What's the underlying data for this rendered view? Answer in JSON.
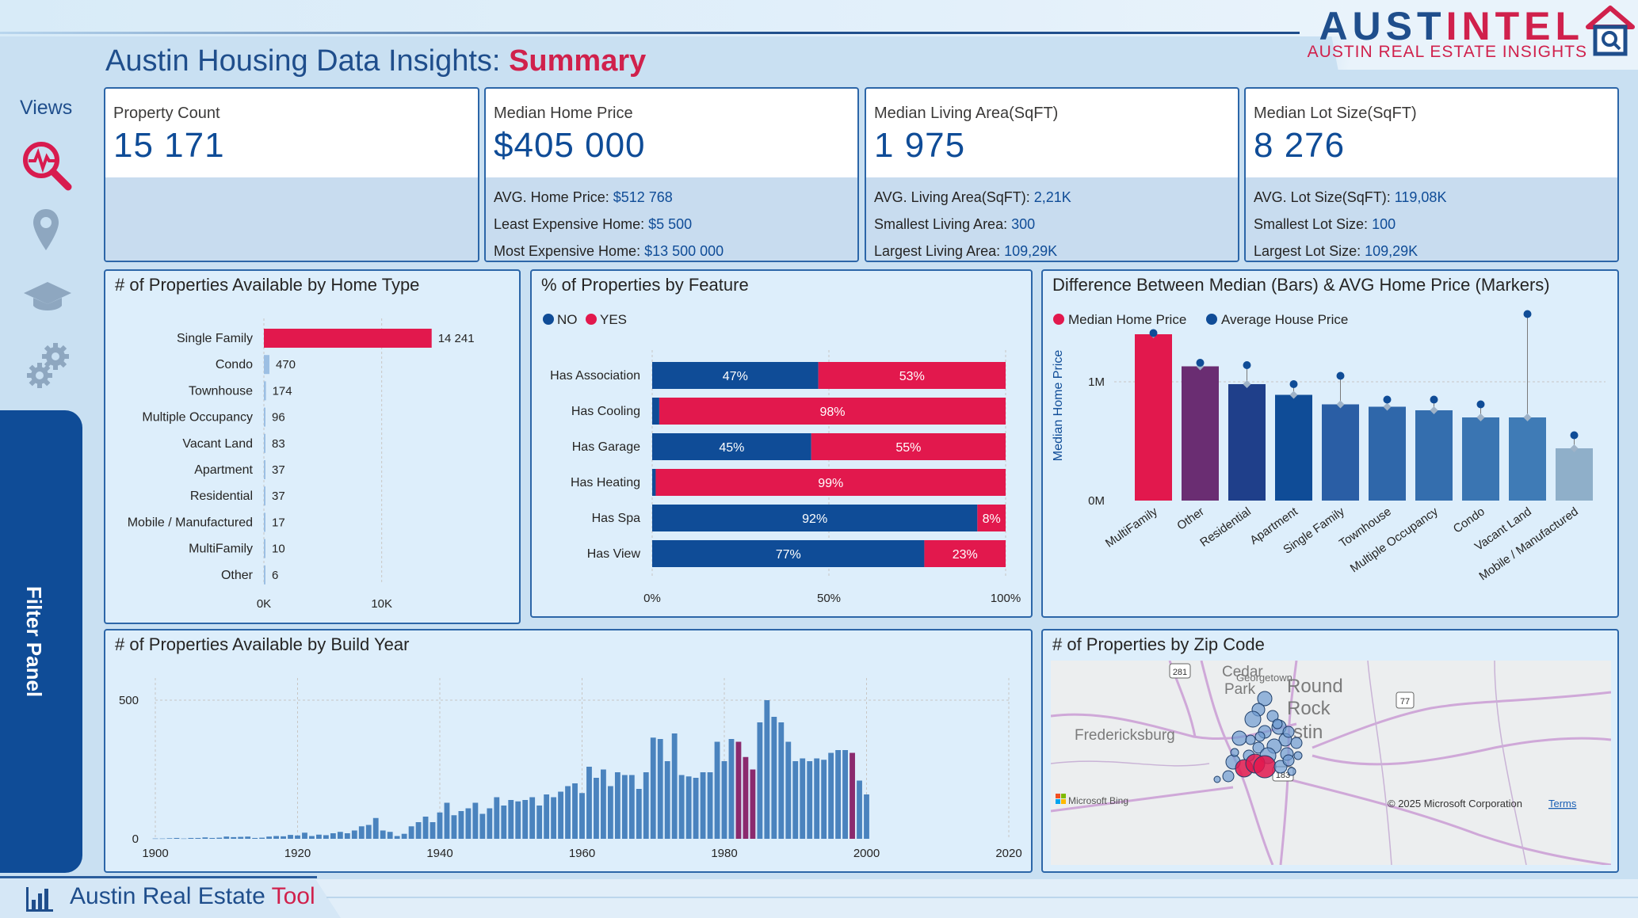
{
  "logo": {
    "word_blue": "AUST",
    "word_red": "INTEL",
    "subtitle": "AUSTIN REAL ESTATE INSIGHTS"
  },
  "title": {
    "main": "Austin Housing Data Insights: ",
    "accent": "Summary"
  },
  "sidebar": {
    "views_label": "Views",
    "icons": [
      "analytics-magnifier-icon",
      "map-pin-icon",
      "graduation-cap-icon",
      "gears-icon"
    ],
    "filter_label": "Filter Panel"
  },
  "footer": {
    "title_prefix": "Austin Real Estate ",
    "title_accent": "Tool"
  },
  "colors": {
    "navy": "#0f4c97",
    "red": "#e2184d",
    "purple": "#8b2a6e",
    "panel": "#ddeefb"
  },
  "kpis": [
    {
      "label": "Property Count",
      "value": "15 171",
      "details": []
    },
    {
      "label": "Median Home Price",
      "value": "$405 000",
      "details": [
        {
          "k": "AVG. Home Price: ",
          "v": "$512 768"
        },
        {
          "k": "Least Expensive Home: ",
          "v": "$5 500"
        },
        {
          "k": "Most Expensive Home: ",
          "v": "$13 500 000"
        }
      ]
    },
    {
      "label": "Median Living Area(SqFT)",
      "value": "1 975",
      "details": [
        {
          "k": "AVG. Living Area(SqFT): ",
          "v": "2,21K"
        },
        {
          "k": "Smallest Living Area: ",
          "v": "300"
        },
        {
          "k": "Largest Living Area: ",
          "v": "109,29K"
        }
      ]
    },
    {
      "label": "Median Lot Size(SqFT)",
      "value": "8 276",
      "details": [
        {
          "k": "AVG. Lot Size(SqFT): ",
          "v": "119,08K"
        },
        {
          "k": "Smallest Lot Size: ",
          "v": "100"
        },
        {
          "k": "Largest Lot Size: ",
          "v": "109,29K"
        }
      ]
    }
  ],
  "panels": {
    "home_type": "# of Properties Available by Home Type",
    "feature": "% of Properties by Feature",
    "median_avg": "Difference Between Median (Bars) & AVG Home Price (Markers)",
    "build_year": "# of Properties Available by Build Year",
    "zip": "# of Properties by Zip Code"
  },
  "map": {
    "labels": [
      "Cedar",
      "Park",
      "Round",
      "Rock",
      "Fredericksburg",
      "stin",
      "Georgetown"
    ],
    "shields": [
      "281",
      "77",
      "183"
    ],
    "bing": "Microsoft Bing",
    "copyright": "© 2025 Microsoft Corporation",
    "terms": "Terms"
  },
  "chart_data": [
    {
      "type": "bar",
      "orientation": "horizontal",
      "categories": [
        "Single Family",
        "Condo",
        "Townhouse",
        "Multiple Occupancy",
        "Vacant Land",
        "Apartment",
        "Residential",
        "Mobile / Manufactured",
        "MultiFamily",
        "Other"
      ],
      "values": [
        14241,
        470,
        174,
        96,
        83,
        37,
        37,
        17,
        10,
        6
      ],
      "value_labels": [
        "14 241",
        "470",
        "174",
        "96",
        "83",
        "37",
        "37",
        "17",
        "10",
        "6"
      ],
      "xticks": [
        "0K",
        "10K"
      ],
      "xtick_values": [
        0,
        10000
      ],
      "xlim": [
        0,
        15000
      ]
    },
    {
      "type": "bar",
      "orientation": "horizontal",
      "stacked": "100%",
      "legend": [
        "NO",
        "YES"
      ],
      "categories": [
        "Has Association",
        "Has Cooling",
        "Has Garage",
        "Has Heating",
        "Has Spa",
        "Has View"
      ],
      "series": [
        {
          "name": "NO",
          "values": [
            47,
            2,
            45,
            1,
            92,
            77
          ]
        },
        {
          "name": "YES",
          "values": [
            53,
            98,
            55,
            99,
            8,
            23
          ]
        }
      ],
      "labels_no": [
        "47%",
        "",
        "45%",
        "",
        "92%",
        "77%"
      ],
      "labels_yes": [
        "53%",
        "98%",
        "55%",
        "99%",
        "8%",
        "23%"
      ],
      "xticks": [
        "0%",
        "50%",
        "100%"
      ]
    },
    {
      "type": "bar",
      "legend": [
        "Median Home Price",
        "Average House Price"
      ],
      "ylabel": "Median Home Price",
      "yticks": [
        "0M",
        "1M"
      ],
      "ylim": [
        0,
        1600000
      ],
      "categories": [
        "MultiFamily",
        "Other",
        "Residential",
        "Apartment",
        "Single Family",
        "Townhouse",
        "Multiple Occupancy",
        "Condo",
        "Vacant Land",
        "Mobile / Manufactured"
      ],
      "series": [
        {
          "name": "Median Home Price",
          "values": [
            1400000,
            1130000,
            980000,
            890000,
            810000,
            790000,
            760000,
            700000,
            700000,
            440000
          ]
        },
        {
          "name": "Average House Price",
          "values": [
            1410000,
            1160000,
            1140000,
            980000,
            1050000,
            850000,
            850000,
            810000,
            1570000,
            550000
          ]
        }
      ],
      "bar_colors": [
        "#e2184d",
        "#6a2d72",
        "#1f3f8a",
        "#0f4c97",
        "#2a5ea5",
        "#2f67aa",
        "#346eae",
        "#3a75b2",
        "#3f7bb6",
        "#8fafc9"
      ]
    },
    {
      "type": "bar",
      "x_start": 1900,
      "x_end": 2020,
      "xticks": [
        1900,
        1920,
        1940,
        1960,
        1980,
        2000,
        2020
      ],
      "yticks": [
        0,
        500
      ],
      "ylim": [
        0,
        500
      ],
      "values": [
        1,
        1,
        2,
        3,
        1,
        3,
        3,
        5,
        3,
        4,
        8,
        6,
        7,
        8,
        3,
        4,
        8,
        10,
        9,
        14,
        12,
        22,
        10,
        15,
        13,
        20,
        25,
        20,
        30,
        45,
        50,
        75,
        30,
        25,
        10,
        18,
        45,
        60,
        80,
        60,
        95,
        130,
        85,
        100,
        110,
        130,
        90,
        110,
        150,
        120,
        140,
        135,
        140,
        150,
        120,
        160,
        150,
        170,
        190,
        200,
        165,
        260,
        220,
        250,
        190,
        240,
        230,
        230,
        180,
        240,
        365,
        360,
        280,
        380,
        230,
        225,
        220,
        240,
        240,
        350,
        280,
        360,
        350,
        295,
        250,
        420,
        500,
        440,
        420,
        350,
        280,
        290,
        280,
        290,
        285,
        310,
        320,
        320,
        310,
        210,
        160
      ],
      "highlight": {
        "1982": "#8b2a6e",
        "1983": "#8b2a6e",
        "1984": "#8b2a6e",
        "1998": "#8b2a6e",
        "2004": "#8b2a6e",
        "2005": "#8b2a6e",
        "2006": "#e2184d",
        "2007": "#8b2a6e"
      }
    }
  ]
}
